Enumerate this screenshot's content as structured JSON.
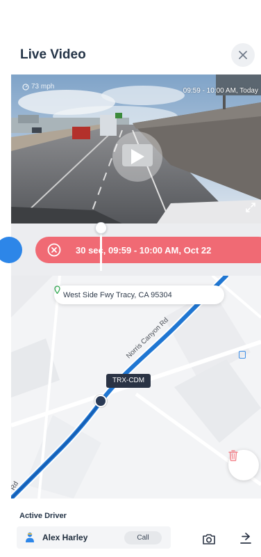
{
  "header": {
    "title": "Live Video",
    "close_icon": "close-icon"
  },
  "video": {
    "speed_text": "73 mph",
    "timestamp": "09:59 - 10:00 AM, Today",
    "play_icon": "play-icon",
    "expand_icon": "expand-icon"
  },
  "timeline": {
    "event_text": "30 sec, 09:59 - 10:00 AM, Oct 22",
    "event_icon": "close-circle-icon",
    "colors": {
      "event": "#f06a74",
      "left_bubble": "#2d86e8"
    }
  },
  "map": {
    "address": "West Side Fwy Tracy, CA 95304",
    "road_label": "Norris Canyon Rd",
    "road_label_partial": "Rd",
    "vehicle_label": "TRX-CDM",
    "pin_icon": "location-pin-icon",
    "trash_icon": "trash-icon",
    "route_color": "#1f76d2"
  },
  "footer": {
    "label": "Active Driver",
    "driver_name": "Alex Harley",
    "call_label": "Call",
    "driver_icon": "driver-icon",
    "camera_icon": "camera-icon",
    "share_icon": "share-icon"
  }
}
